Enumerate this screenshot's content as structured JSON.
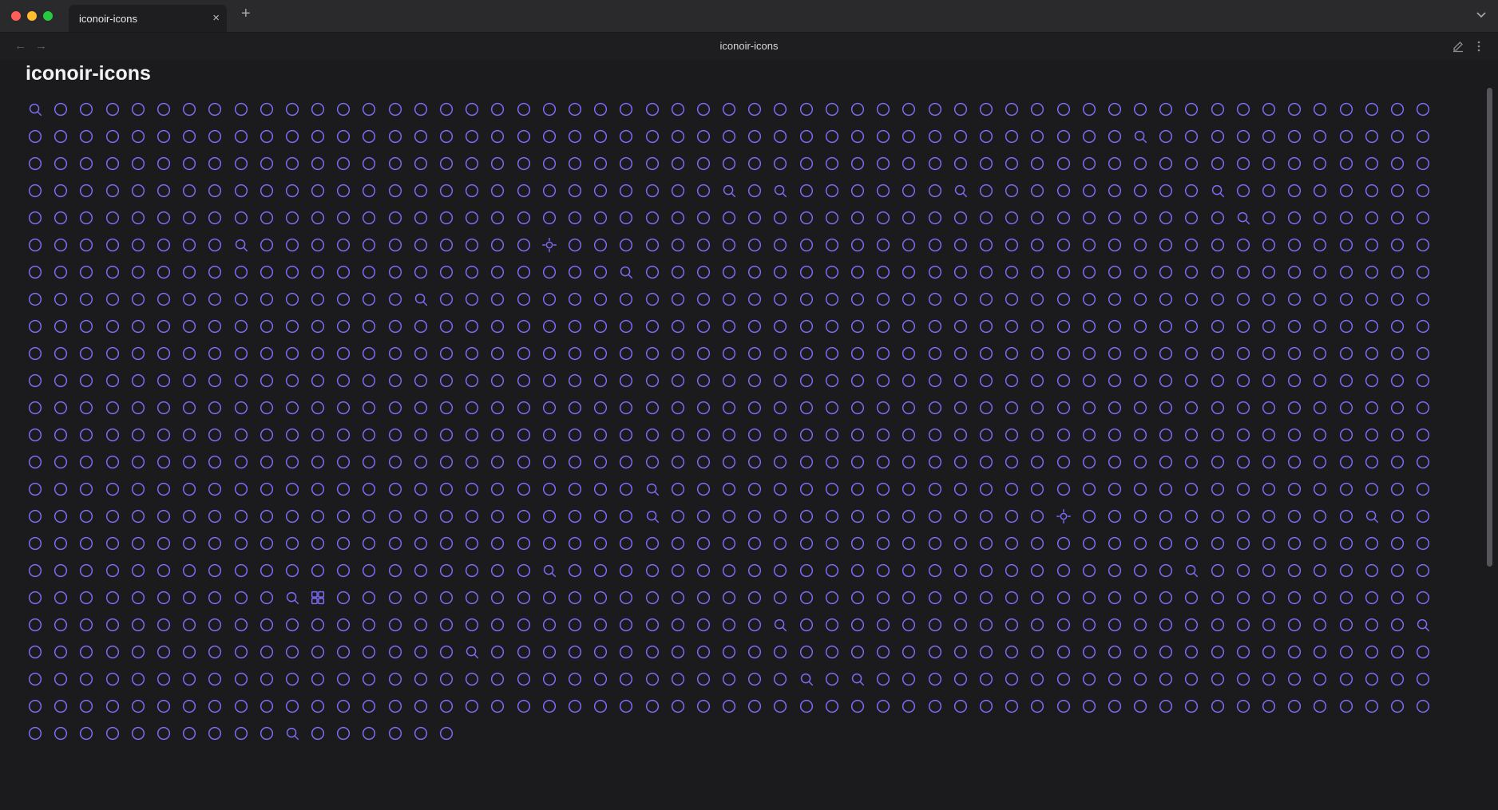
{
  "window": {
    "tab_title": "iconoir-icons",
    "close_glyph": "×",
    "new_tab_glyph": "+",
    "back_glyph": "←",
    "forward_glyph": "→",
    "url": "iconoir-icons"
  },
  "page": {
    "title": "iconoir-icons",
    "icon_color": "#7c6cf6",
    "icon_count": 1282
  }
}
